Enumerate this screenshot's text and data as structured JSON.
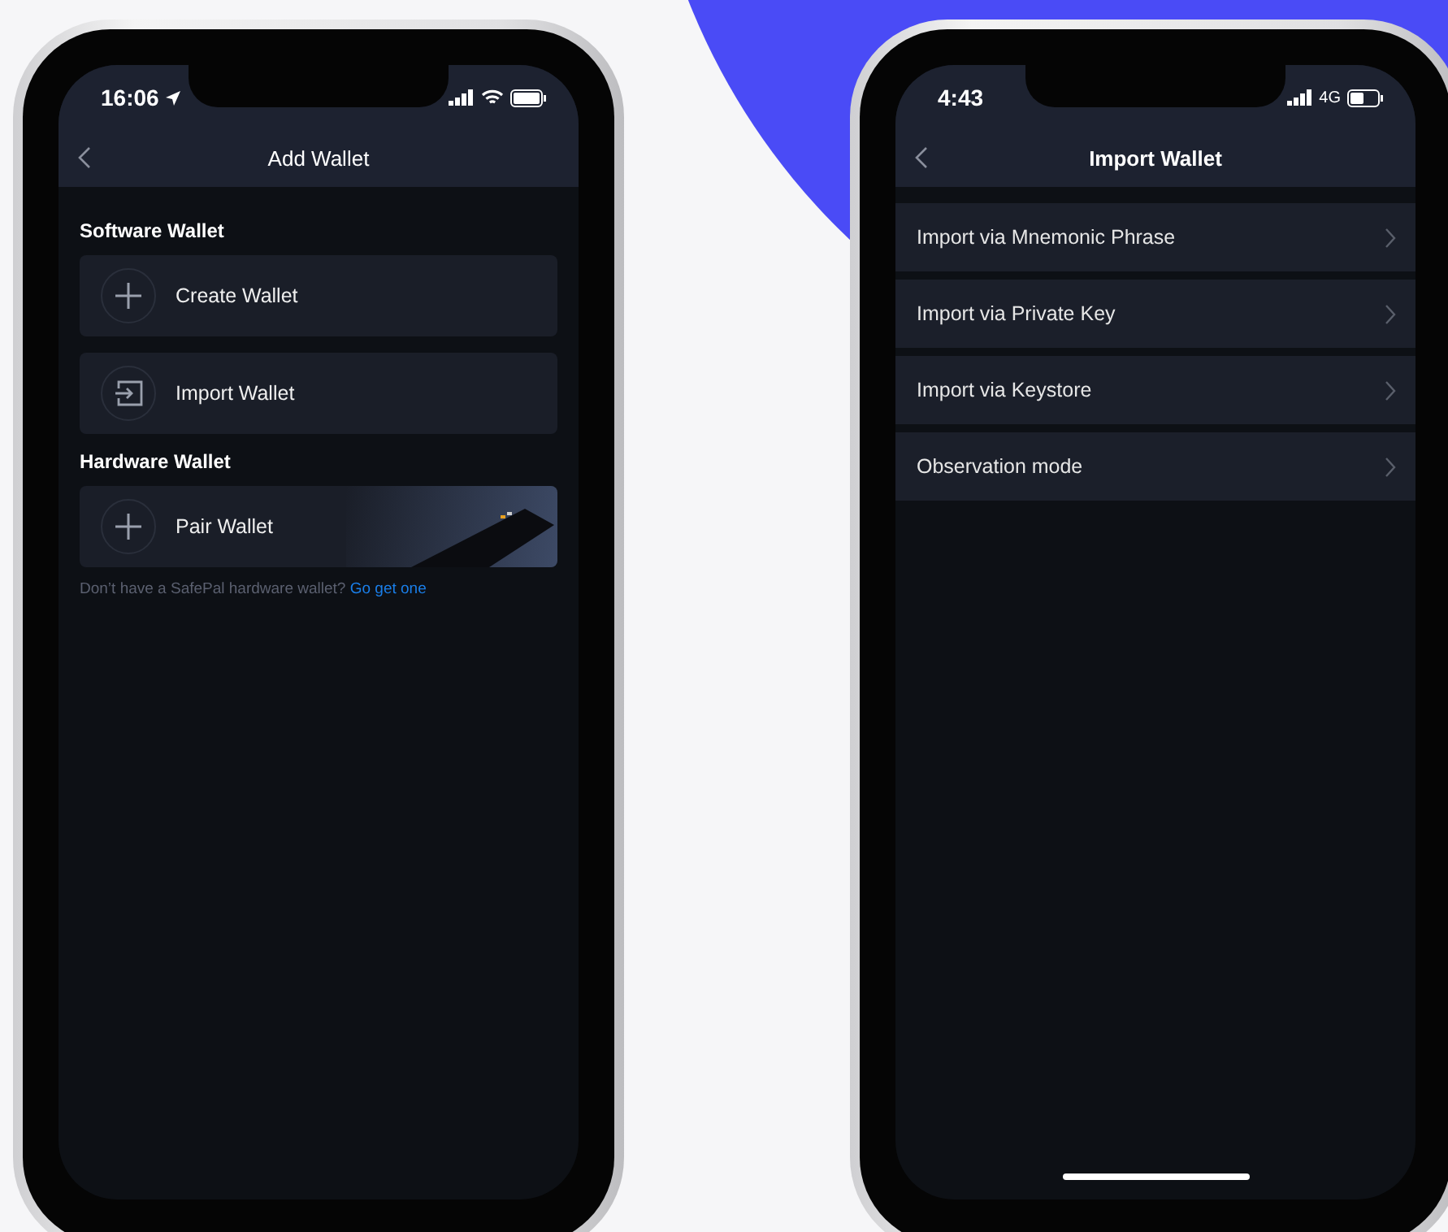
{
  "phones": [
    {
      "kind": "add_wallet",
      "status_bar": {
        "time": "16:06"
      },
      "title": "Add Wallet",
      "sections": [
        {
          "heading": "Software Wallet",
          "items": [
            {
              "kind": "plus",
              "label": "Create Wallet"
            },
            {
              "kind": "import",
              "label": "Import Wallet"
            }
          ]
        },
        {
          "heading": "Hardware Wallet",
          "items": [
            {
              "kind": "pair",
              "label": "Pair Wallet"
            }
          ]
        }
      ],
      "footer": {
        "text": "Don’t have a SafePal hardware wallet?",
        "link": "Go get one"
      }
    },
    {
      "kind": "import_wallet",
      "status_bar": {
        "time": "4:43",
        "network": "4G"
      },
      "title": "Import Wallet",
      "options": [
        "Import via Mnemonic Phrase",
        "Import via Private Key",
        "Import via Keystore",
        "Observation mode"
      ]
    }
  ]
}
